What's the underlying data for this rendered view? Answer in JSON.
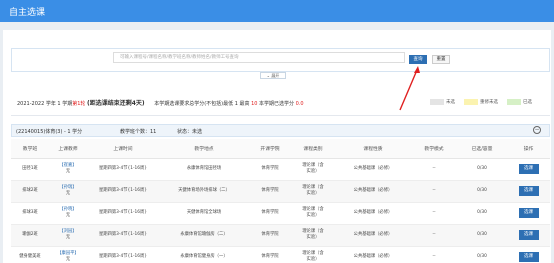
{
  "header": {
    "title": "自主选课"
  },
  "search": {
    "placeholder": "可输入课程号/课程名称/教学班名称/教师姓名/教师工号查询",
    "query_label": "查询",
    "reset_label": "重置",
    "expand_label": "展开"
  },
  "info": {
    "term_prefix": "2021-2022 学年 1 学期",
    "round": "第1轮",
    "deadline": "(距选课结束还剩4天)",
    "min_credit_label": "本学期选课要求总学分(不包括)最低 1 最高",
    "max_credit": "10",
    "selected_label": "本学期已选学分",
    "selected_credit": "0.0"
  },
  "legend": [
    {
      "label": "未选",
      "color": "#e4e4e4"
    },
    {
      "label": "重修未选",
      "color": "#fbf3b0"
    },
    {
      "label": "已选",
      "color": "#d6f0c6"
    }
  ],
  "course_bar": {
    "code": "(22140015)体育(3) - 1 学分",
    "teach_count": "教学班个数：11",
    "status": "状态：未选",
    "collapse_icon": "collapse-icon"
  },
  "table": {
    "headers": [
      "教学班",
      "上课教师",
      "上课时间",
      "教学地点",
      "开课学院",
      "课程类别",
      "课程性质",
      "教学模式",
      "已选/容量",
      "操作"
    ],
    "rows": [
      {
        "cls": "田径1班",
        "teacher": "【崔嘉】",
        "teacher_sub": "无",
        "time": "星期四第3-4节{1-16周}",
        "place": "永康体育馆田径场",
        "college": "体育学院",
        "category_1": "理论课（含",
        "category_2": "实验）",
        "nature": "公共基础课（必修）",
        "mode": "--",
        "count": "0/30",
        "action": "选课"
      },
      {
        "cls": "排球2班",
        "teacher": "【孙瑞】",
        "teacher_sub": "无",
        "time": "星期四第3-4节{1-16周}",
        "place": "天健体育场外场排球（二）",
        "college": "体育学院",
        "category_1": "理论课（含",
        "category_2": "实验）",
        "nature": "公共基础课（必修）",
        "mode": "--",
        "count": "0/30",
        "action": "选课"
      },
      {
        "cls": "排球3班",
        "teacher": "【孙晓】",
        "teacher_sub": "无",
        "time": "星期四第3-4节{1-16周}",
        "place": "天健体育馆全球场",
        "college": "体育学院",
        "category_1": "理论课（含",
        "category_2": "实验）",
        "nature": "公共基础课（必修）",
        "mode": "--",
        "count": "0/30",
        "action": "选课"
      },
      {
        "cls": "瑜伽2班",
        "teacher": "【刘园】",
        "teacher_sub": "无",
        "time": "星期四第3-4节{1-16周}",
        "place": "永康体育馆瑜伽房（二）",
        "college": "体育学院",
        "category_1": "理论课（含",
        "category_2": "实验）",
        "nature": "公共基础课（必修）",
        "mode": "--",
        "count": "0/30",
        "action": "选课"
      },
      {
        "cls": "健身健美班",
        "teacher": "【康园平】",
        "teacher_sub": "无",
        "time": "星期四第3-4节{1-16周}",
        "place": "永康体育馆健身房（一）",
        "college": "体育学院",
        "category_1": "理论课（含",
        "category_2": "实验）",
        "nature": "公共基础课（必修）",
        "mode": "--",
        "count": "0/30",
        "action": "选课"
      }
    ]
  },
  "colors": {
    "accent": "#3a8ee6",
    "button": "#2d6fb3",
    "arrow": "#e02020"
  }
}
